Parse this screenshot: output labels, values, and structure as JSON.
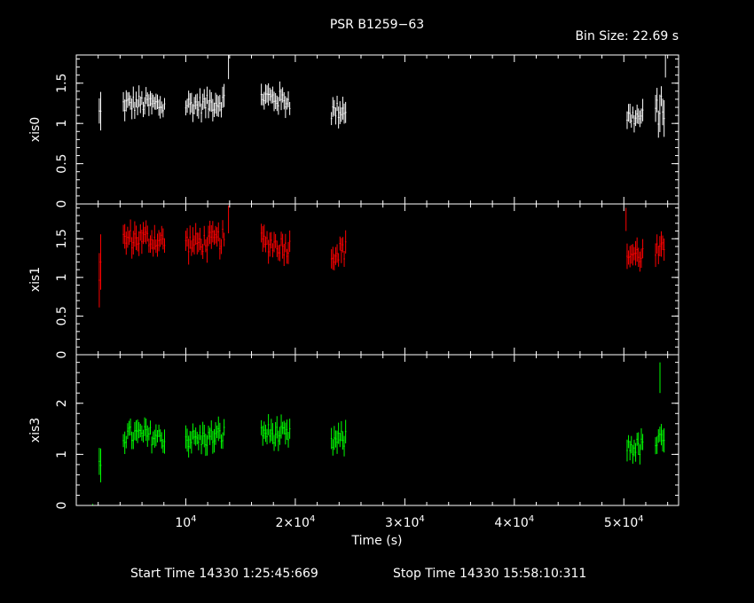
{
  "chart_data": {
    "type": "line",
    "title": "PSR B1259−63",
    "bin_size_label": "Bin Size: 22.69 s",
    "xlabel": "Time (s)",
    "xlim": [
      0,
      55000
    ],
    "x_ticks": [
      {
        "value": 10000,
        "label": "10",
        "exp": "4",
        "mant": ""
      },
      {
        "value": 20000,
        "label": "2×10",
        "exp": "4",
        "mant": "2×"
      },
      {
        "value": 30000,
        "label": "3×10",
        "exp": "4",
        "mant": "3×"
      },
      {
        "value": 40000,
        "label": "4×10",
        "exp": "4",
        "mant": "4×"
      },
      {
        "value": 50000,
        "label": "5×10",
        "exp": "4",
        "mant": "5×"
      }
    ],
    "start_time_label": "Start Time 14330  1:25:45:669",
    "stop_time_label": "Stop Time 14330 15:58:10:311",
    "panels": [
      {
        "ylabel": "xis0",
        "color": "#ffffff",
        "ylim": [
          0,
          1.85
        ],
        "y_ticks": [
          {
            "value": 0,
            "label": "0"
          },
          {
            "value": 0.5,
            "label": "0.5"
          },
          {
            "value": 1,
            "label": "1"
          },
          {
            "value": 1.5,
            "label": "1.5"
          }
        ],
        "segments": [
          {
            "x0": 2100,
            "x1": 2300,
            "level": 1.15,
            "err": 0.2
          },
          {
            "x0": 4300,
            "x1": 8100,
            "level": 1.2,
            "err": 0.12
          },
          {
            "x0": 10000,
            "x1": 13600,
            "level": 1.28,
            "err": 0.12
          },
          {
            "x0": 16900,
            "x1": 19600,
            "level": 1.3,
            "err": 0.12
          },
          {
            "x0": 23300,
            "x1": 24600,
            "level": 1.15,
            "err": 0.12
          },
          {
            "x0": 50300,
            "x1": 51800,
            "level": 1.12,
            "err": 0.12
          },
          {
            "x0": 52900,
            "x1": 53700,
            "level": 1.2,
            "err": 0.2
          }
        ],
        "spikes": [
          {
            "x": 13900,
            "y": 1.7,
            "err": 0.15
          },
          {
            "x": 53800,
            "y": 1.72,
            "err": 0.15
          }
        ]
      },
      {
        "ylabel": "xis1",
        "color": "#ff0000",
        "ylim": [
          0,
          1.95
        ],
        "y_ticks": [
          {
            "value": 0,
            "label": "0"
          },
          {
            "value": 0.5,
            "label": "0.5"
          },
          {
            "value": 1,
            "label": "1"
          },
          {
            "value": 1.5,
            "label": "1.5"
          }
        ],
        "segments": [
          {
            "x0": 2100,
            "x1": 2300,
            "level": 1.15,
            "err": 0.3
          },
          {
            "x0": 4300,
            "x1": 8100,
            "level": 1.45,
            "err": 0.14
          },
          {
            "x0": 10000,
            "x1": 13600,
            "level": 1.5,
            "err": 0.14
          },
          {
            "x0": 16900,
            "x1": 19600,
            "level": 1.42,
            "err": 0.14
          },
          {
            "x0": 23300,
            "x1": 24600,
            "level": 1.32,
            "err": 0.14
          },
          {
            "x0": 50300,
            "x1": 51800,
            "level": 1.35,
            "err": 0.14
          },
          {
            "x0": 52900,
            "x1": 53700,
            "level": 1.35,
            "err": 0.14
          }
        ],
        "spikes": [
          {
            "x": 13900,
            "y": 1.75,
            "err": 0.18
          },
          {
            "x": 50200,
            "y": 1.75,
            "err": 0.15
          }
        ]
      },
      {
        "ylabel": "xis3",
        "color": "#00ff00",
        "ylim": [
          0,
          2.95
        ],
        "y_ticks": [
          {
            "value": 0,
            "label": "0"
          },
          {
            "value": 1,
            "label": "1"
          },
          {
            "value": 2,
            "label": "2"
          }
        ],
        "segments": [
          {
            "x0": 2100,
            "x1": 2300,
            "level": 1.05,
            "err": 0.3
          },
          {
            "x0": 4300,
            "x1": 8100,
            "level": 1.3,
            "err": 0.2
          },
          {
            "x0": 10000,
            "x1": 13600,
            "level": 1.38,
            "err": 0.2
          },
          {
            "x0": 16900,
            "x1": 19600,
            "level": 1.38,
            "err": 0.2
          },
          {
            "x0": 23300,
            "x1": 24600,
            "level": 1.25,
            "err": 0.2
          },
          {
            "x0": 50300,
            "x1": 51800,
            "level": 1.22,
            "err": 0.2
          },
          {
            "x0": 52900,
            "x1": 53700,
            "level": 1.28,
            "err": 0.2
          }
        ],
        "spikes": [
          {
            "x": 53300,
            "y": 2.5,
            "err": 0.3
          },
          {
            "x": 1500,
            "y": 0.02,
            "err": 0.01
          }
        ]
      }
    ]
  }
}
